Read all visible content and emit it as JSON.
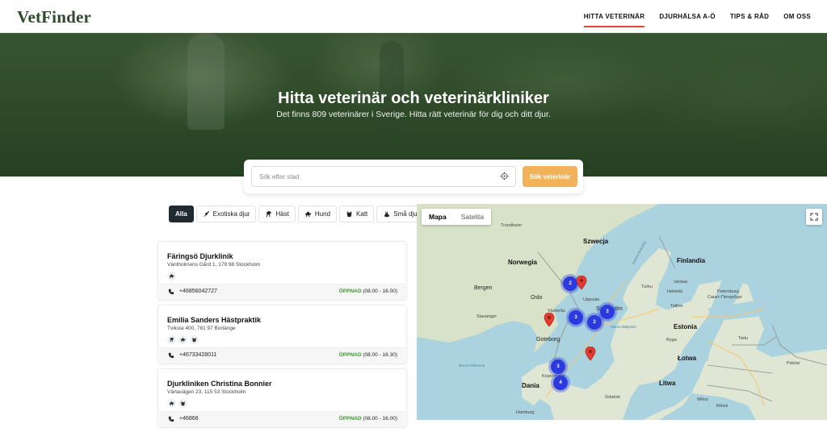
{
  "header": {
    "logo": "VetFinder",
    "nav": [
      {
        "label": "HITTA VETERINÄR",
        "active": true
      },
      {
        "label": "DJURHÄLSA A-Ö",
        "active": false
      },
      {
        "label": "TIPS & RÅD",
        "active": false
      },
      {
        "label": "OM OSS",
        "active": false
      }
    ]
  },
  "hero": {
    "title": "Hitta veterinär och veterinärkliniker",
    "subtitle": "Det finns 809 veterinärer i Sverige. Hitta rätt veterinär för dig och ditt djur."
  },
  "search": {
    "placeholder": "Sök efter stad",
    "button": "Sök veterinär",
    "locate_icon": "crosshair-icon"
  },
  "filters": [
    {
      "label": "Alla",
      "icon": "",
      "active": true
    },
    {
      "label": "Exotiska djur",
      "icon": "lizard-icon",
      "active": false
    },
    {
      "label": "Häst",
      "icon": "horse-icon",
      "active": false
    },
    {
      "label": "Hund",
      "icon": "dog-icon",
      "active": false
    },
    {
      "label": "Katt",
      "icon": "cat-icon",
      "active": false
    },
    {
      "label": "Små djur",
      "icon": "rabbit-icon",
      "active": false
    }
  ],
  "clinics": [
    {
      "name": "Färingsö Djurklinik",
      "address": "Väntholmens Gård 1, 179 98 Stockholm",
      "animals": [
        "dog-icon"
      ],
      "phone": "+46856042727",
      "status": "ÖPPNAD",
      "hours": "(08.00 - 16.00)"
    },
    {
      "name": "Emilia Sanders Hästpraktik",
      "address": "Tviksta 400, 781 97 Borlänge",
      "animals": [
        "horse-icon",
        "dog-icon",
        "cat-icon"
      ],
      "phone": "+46733428011",
      "status": "ÖPPNAD",
      "hours": "(08.00 - 16.30)"
    },
    {
      "name": "Djurkliniken Christina Bonnier",
      "address": "Värtavägen 23, 115 53 Stockholm",
      "animals": [
        "dog-icon",
        "cat-icon"
      ],
      "phone": "+46866",
      "status": "ÖPPNAD",
      "hours": "(08.00 - 16.00)"
    }
  ],
  "map": {
    "tabs": [
      {
        "label": "Mapa",
        "active": true
      },
      {
        "label": "Satelita",
        "active": false
      }
    ],
    "fullscreen_icon": "fullscreen-icon",
    "labels": {
      "szwecja": "Szwecja",
      "norwegia": "Norwegia",
      "finlandia": "Finlandia",
      "estonia": "Estonia",
      "lotwa": "Łotwa",
      "litwa": "Litwa",
      "dania": "Dania",
      "trondheim": "Trondheim",
      "bergen": "Bergen",
      "oslo": "Oslo",
      "stavanger": "Stavanger",
      "goteborg": "Goteborg",
      "uppsala": "Uppsala",
      "stockholm": "Sztokholm",
      "turku": "Turku",
      "helsinki": "Helsinki",
      "tallinn": "Tallinn",
      "petersburg": "Petersburg",
      "petersburg_ru": "Санкт-Петербург",
      "ryga": "Ryga",
      "kopenhaga": "Kopenhaga",
      "gdansk": "Gdańsk",
      "hamburg": "Hamburg",
      "minsk": "Mińsk",
      "wilno": "Wilno",
      "pskow": "Psków",
      "zatoka": "Zatoka Botnicka",
      "baltic": "Morze Bałtyckie",
      "north_sea": "Morze Północne",
      "vantaa": "Vantaa",
      "tartu": "Tartu",
      "vasteras": "Västerås"
    },
    "clusters": [
      {
        "count": "2"
      },
      {
        "count": "3"
      },
      {
        "count": "3"
      },
      {
        "count": "2"
      },
      {
        "count": "3"
      },
      {
        "count": "4"
      }
    ],
    "pins": 3,
    "brand_colors": {
      "pin": "#e23b2f",
      "cluster": "#2b3adf",
      "accent": "#f2b25a",
      "nav_underline": "#e2453c"
    }
  }
}
